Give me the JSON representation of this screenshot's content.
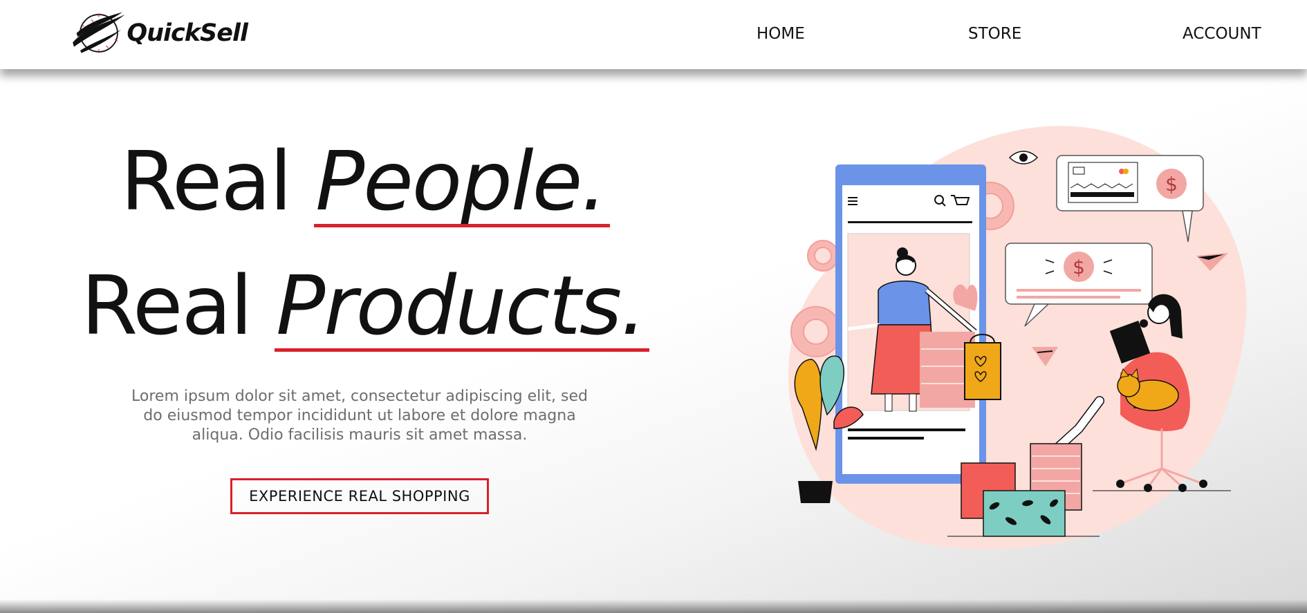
{
  "brand": {
    "name": "QuickSell",
    "logo_icon": "swoosh-globe-icon"
  },
  "nav": {
    "items": [
      {
        "label": "HOME"
      },
      {
        "label": "STORE"
      },
      {
        "label": "ACCOUNT"
      }
    ]
  },
  "hero": {
    "line1_plain": "Real ",
    "line1_emph": "People.",
    "line2_plain": "Real ",
    "line2_emph": "Products.",
    "description": "Lorem ipsum dolor sit amet, consectetur adipiscing elit, sed do eiusmod tempor incididunt ut labore et dolore magna aliqua. Odio facilisis mauris sit amet massa.",
    "cta_label": "EXPERIENCE REAL SHOPPING"
  },
  "colors": {
    "accent": "#d9202a",
    "phone": "#6b94e8",
    "blush": "#fde0da",
    "coral": "#f35d57",
    "mustard": "#f0a818",
    "teal": "#7ecdc3"
  }
}
